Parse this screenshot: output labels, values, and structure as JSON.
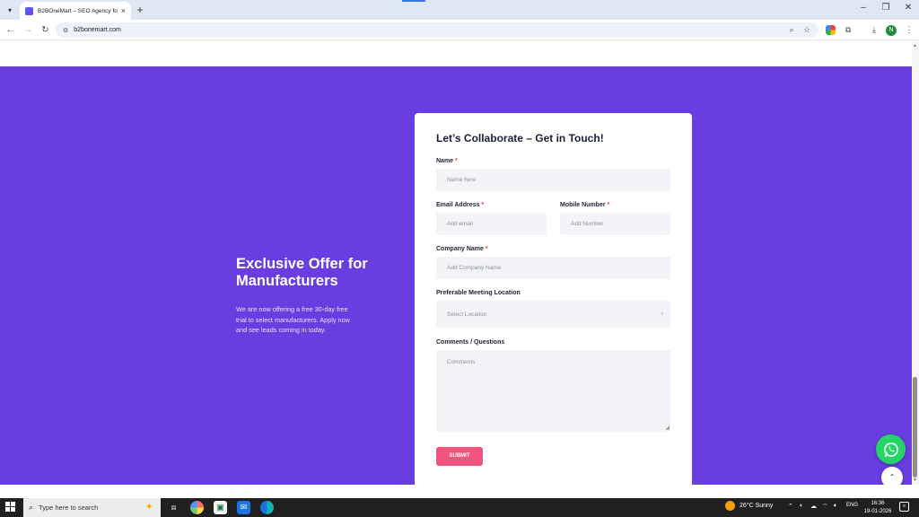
{
  "browser": {
    "tab_title": "B2BOneMart – SEO Agency for",
    "url": "b2bonemart.com",
    "profile_initial": "N"
  },
  "offer": {
    "title": "Exclusive Offer for Manufacturers",
    "text": "We are now offering a free 30-day free trial to select manufacturers. Apply now and see leads coming in today."
  },
  "form": {
    "title": "Let’s Collaborate – Get in Touch!",
    "required_mark": "*",
    "name_label": "Name",
    "name_placeholder": "Name here",
    "email_label": "Email Address",
    "email_placeholder": "Add email",
    "mobile_label": "Mobile Number",
    "mobile_placeholder": "Add Number",
    "company_label": "Company Name",
    "company_placeholder": "Add Company Name",
    "location_label": "Preferable Meeting Location",
    "location_selected": "Select Location",
    "comments_label": "Comments / Questions",
    "comments_placeholder": "Comments",
    "submit_label": "SUBMIT"
  },
  "taskbar": {
    "search_placeholder": "Type here to search",
    "weather": "26°C  Sunny",
    "language": "ENG",
    "time": "16:36",
    "date": "19-01-2026"
  },
  "colors": {
    "section_bg": "#6a3de0",
    "submit_bg": "#f0557e",
    "whatsapp": "#25d366"
  }
}
